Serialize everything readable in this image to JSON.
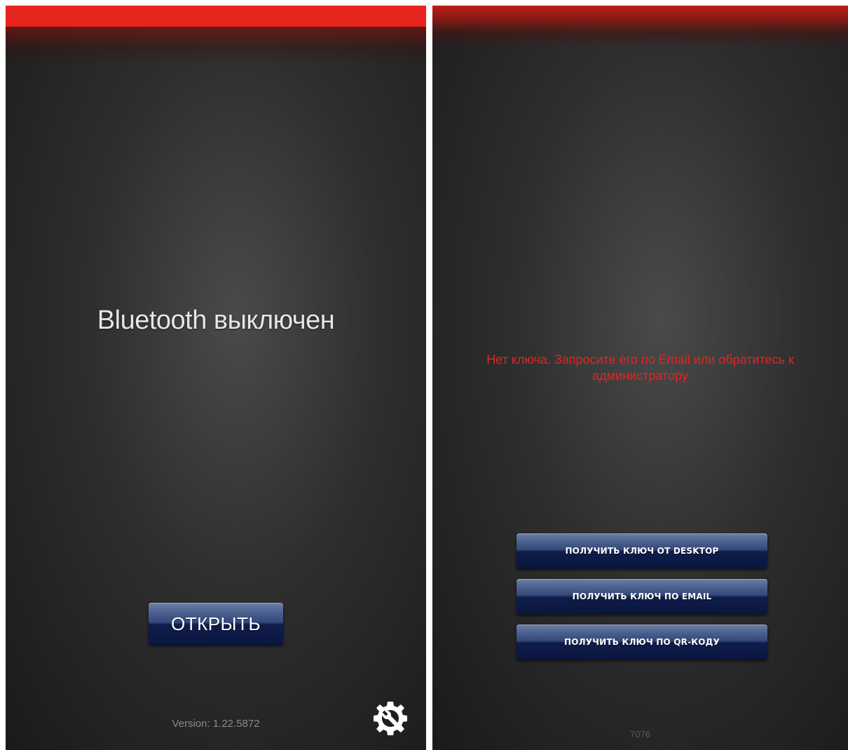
{
  "left_screen": {
    "status_title": "Bluetooth выключен",
    "open_button_label": "ОТКРЫТЬ",
    "version_text": "Version: 1.22.5872",
    "settings_icon": "settings-wrench-gear-icon"
  },
  "right_screen": {
    "error_message": "Нет ключа. Запросите его по Email или обратитесь к администратору",
    "buttons": [
      {
        "label": "ПОЛУЧИТЬ КЛЮЧ ОТ DESKTOP"
      },
      {
        "label": "ПОЛУЧИТЬ КЛЮЧ ПО EMAIL"
      },
      {
        "label": "ПОЛУЧИТЬ КЛЮЧ ПО QR-КОДУ"
      }
    ],
    "bottom_number": "7076"
  },
  "colors": {
    "accent_red": "#e8241e",
    "button_navy": "#0f1d4a",
    "background_dark": "#2e2e2e",
    "error_text": "#e0251f"
  }
}
